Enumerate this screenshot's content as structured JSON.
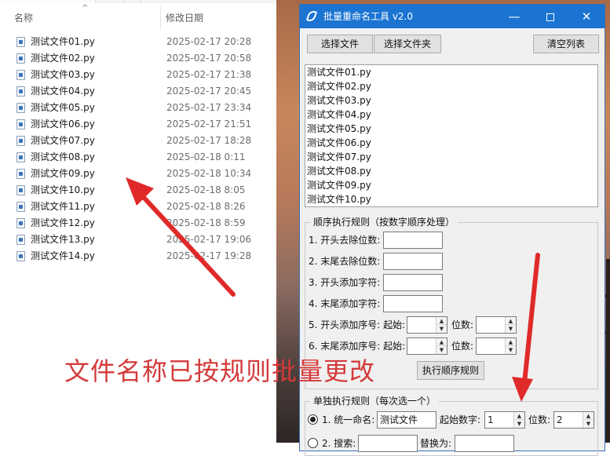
{
  "explorer": {
    "headers": {
      "name": "名称",
      "date": "修改日期"
    },
    "sort_glyph": "^",
    "files": [
      {
        "name": "测试文件01.py",
        "date": "2025-02-17 20:28"
      },
      {
        "name": "测试文件02.py",
        "date": "2025-02-17 20:58"
      },
      {
        "name": "测试文件03.py",
        "date": "2025-02-17 21:38"
      },
      {
        "name": "测试文件04.py",
        "date": "2025-02-17 20:45"
      },
      {
        "name": "测试文件05.py",
        "date": "2025-02-17 23:34"
      },
      {
        "name": "测试文件06.py",
        "date": "2025-02-17 21:51"
      },
      {
        "name": "测试文件07.py",
        "date": "2025-02-17 18:28"
      },
      {
        "name": "测试文件08.py",
        "date": "2025-02-18 0:11"
      },
      {
        "name": "测试文件09.py",
        "date": "2025-02-18 10:34"
      },
      {
        "name": "测试文件10.py",
        "date": "2025-02-18 8:05"
      },
      {
        "name": "测试文件11.py",
        "date": "2025-02-18 8:26"
      },
      {
        "name": "测试文件12.py",
        "date": "2025-02-18 8:59"
      },
      {
        "name": "测试文件13.py",
        "date": "2025-02-17 19:06"
      },
      {
        "name": "测试文件14.py",
        "date": "2025-02-17 19:28"
      }
    ]
  },
  "window": {
    "title": "批量重命名工具 v2.0",
    "controls": {
      "minimize": "—",
      "close": "✕"
    },
    "toolbar": {
      "select_files": "选择文件",
      "select_folder": "选择文件夹",
      "clear_list": "清空列表"
    },
    "file_list": [
      "测试文件01.py",
      "测试文件02.py",
      "测试文件03.py",
      "测试文件04.py",
      "测试文件05.py",
      "测试文件06.py",
      "测试文件07.py",
      "测试文件08.py",
      "测试文件09.py",
      "测试文件10.py"
    ],
    "sequential": {
      "legend": "顺序执行规则（按数字顺序处理）",
      "rule1": "1. 开头去除位数:",
      "rule2": "2. 末尾去除位数:",
      "rule3": "3. 开头添加字符:",
      "rule4": "4. 末尾添加字符:",
      "rule5": "5. 开头添加序号: 起始:",
      "rule6": "6. 末尾添加序号: 起始:",
      "digits_label": "位数:",
      "execute_button": "执行顺序规则"
    },
    "single": {
      "legend": "单独执行规则（每次选一个）",
      "rename_label": "1. 统一命名:",
      "rename_value": "测试文件",
      "start_label": "起始数字:",
      "start_value": "1",
      "digits_label": "位数:",
      "digits_value": "2",
      "search_label": "2. 搜索:",
      "replace_label": "替换为:"
    }
  },
  "annotation": {
    "caption": "文件名称已按规则批量更改",
    "arrow_color": "#e02a2a"
  }
}
